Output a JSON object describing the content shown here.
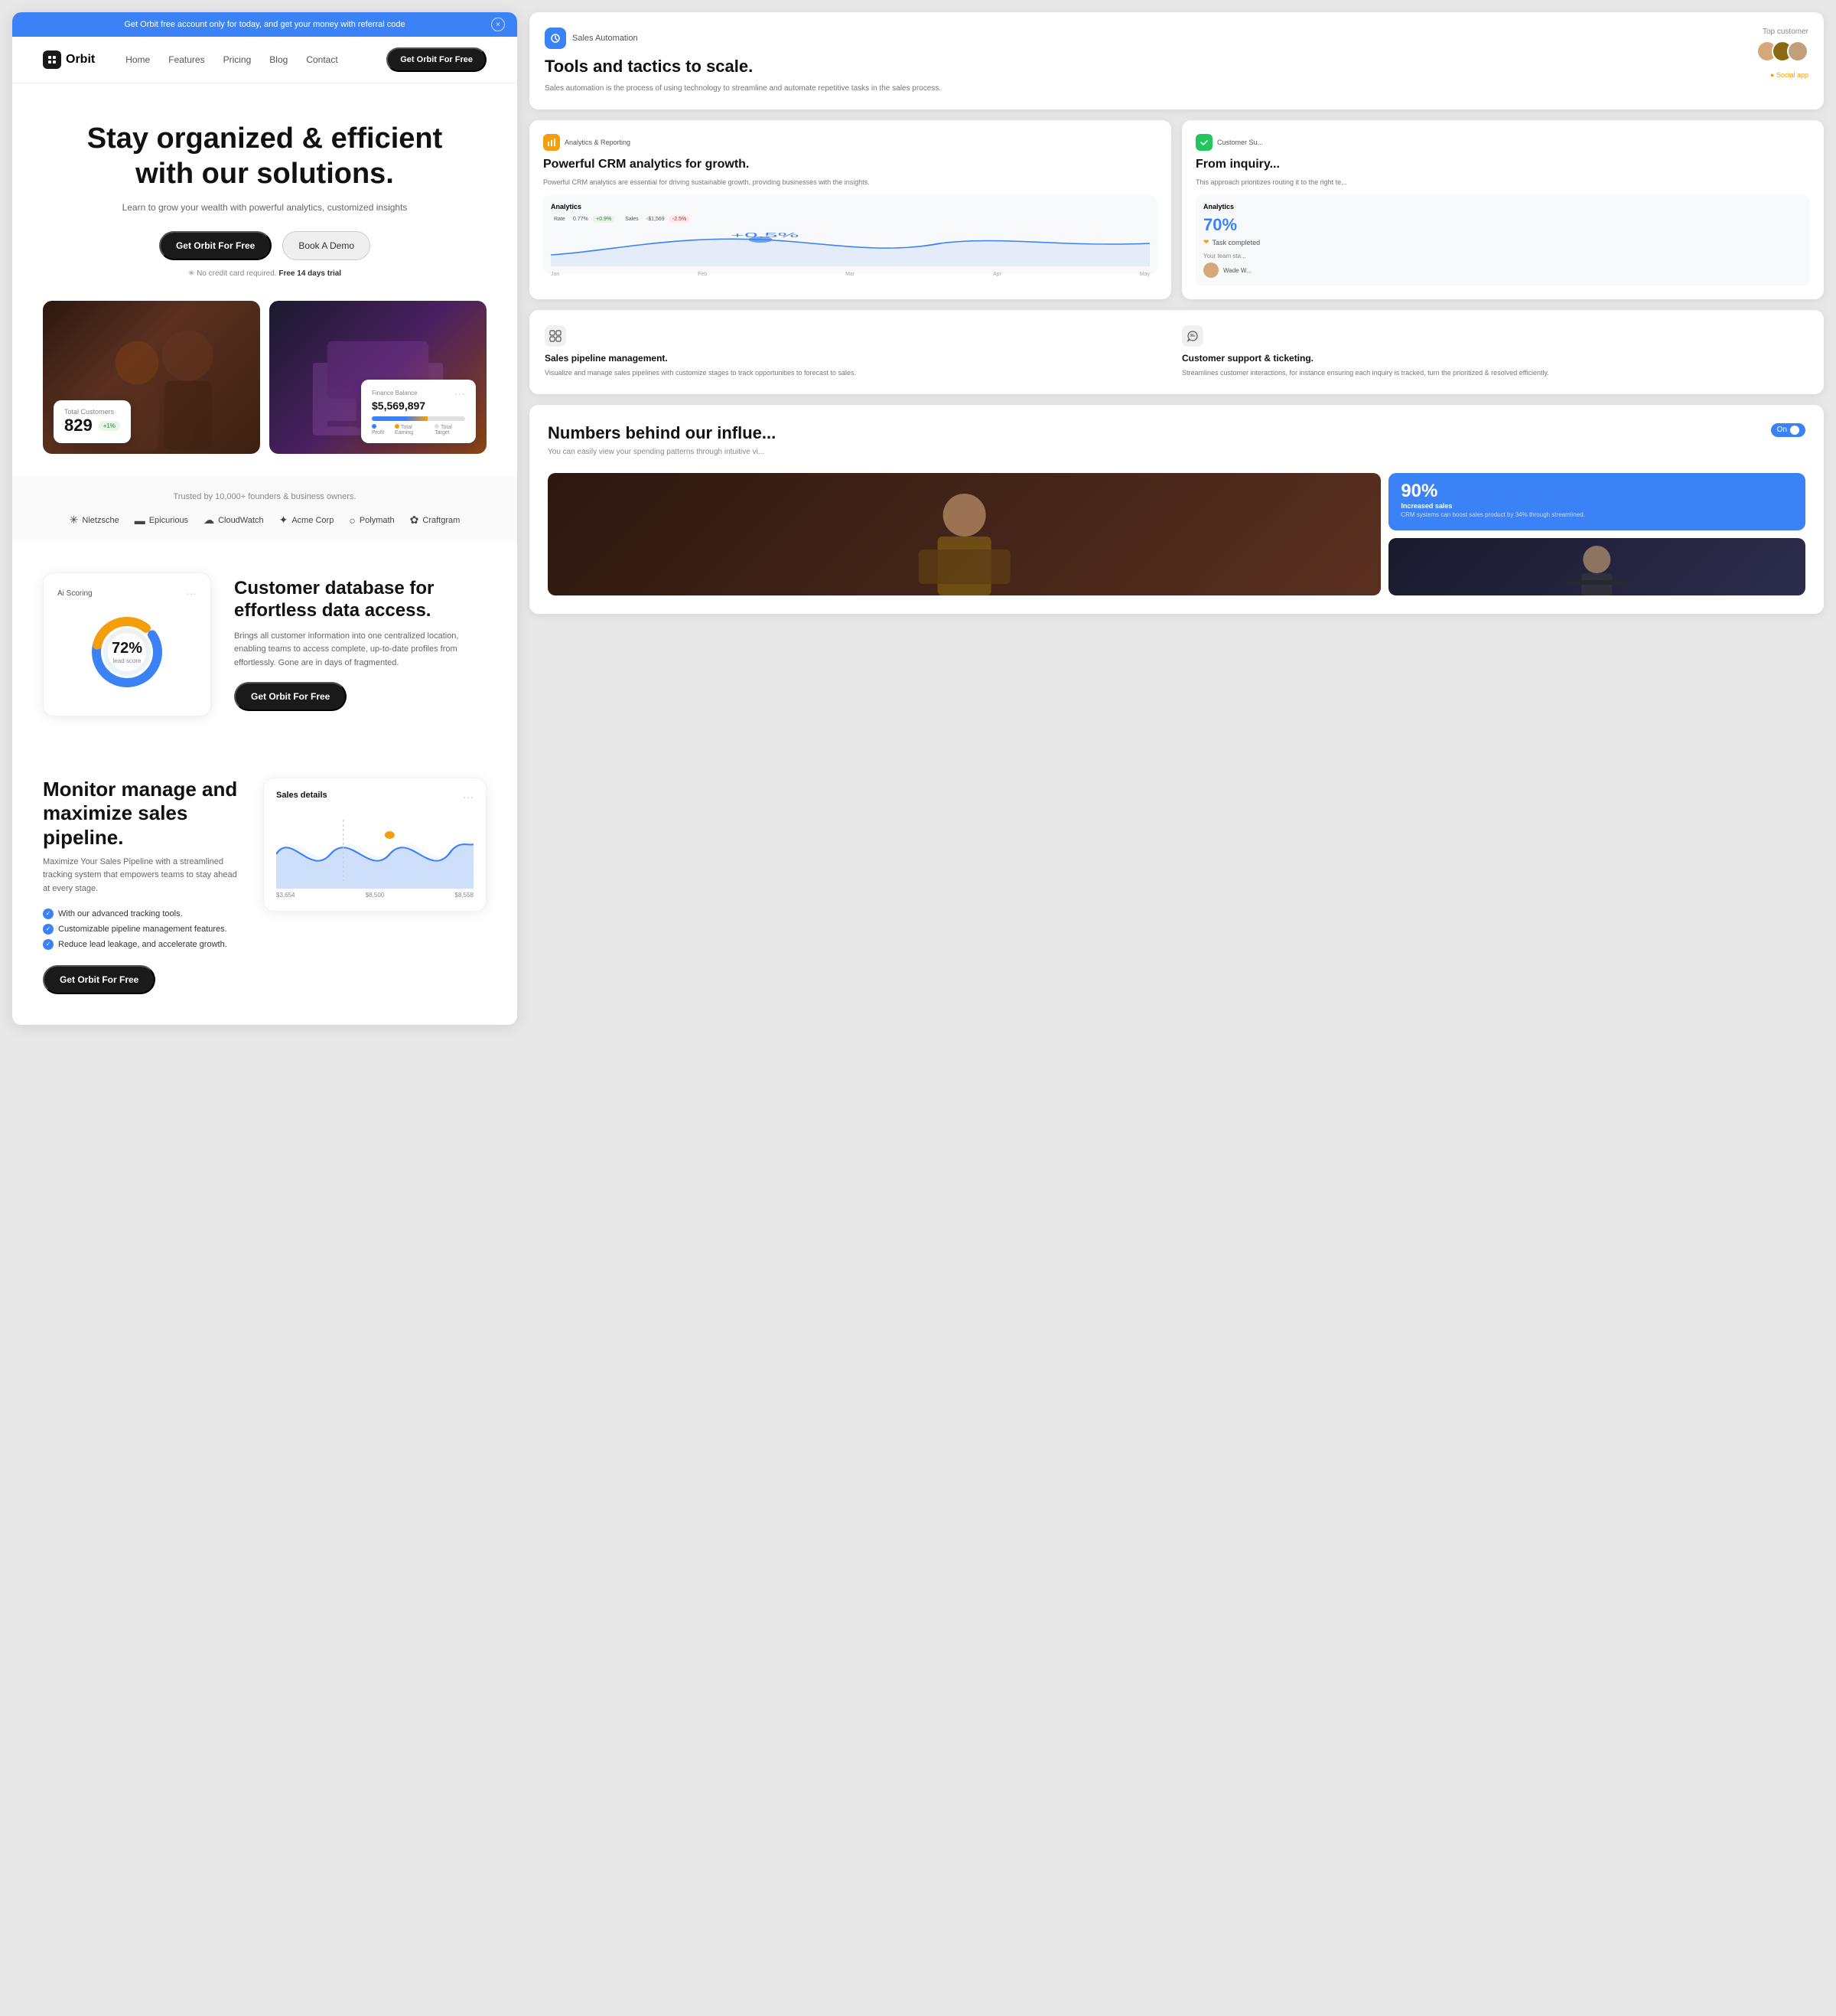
{
  "banner": {
    "text": "Get Orbit free account only for today, and get your money with referral code",
    "close_label": "×"
  },
  "nav": {
    "logo": "Orbit",
    "links": [
      "Home",
      "Features",
      "Pricing",
      "Blog",
      "Contact"
    ],
    "cta": "Get Orbit For Free"
  },
  "hero": {
    "heading_line1": "Stay organized & efficient",
    "heading_line2": "with our solutions.",
    "subtext": "Learn to grow your wealth with powerful analytics, customized insights",
    "cta_primary": "Get Orbit For Free",
    "cta_secondary": "Book A Demo",
    "note": "No credit card required.",
    "note_bold": "Free 14 days trial",
    "widget_customers_label": "Total Customers",
    "widget_customers_value": "829",
    "widget_customers_badge": "+1%",
    "finance_title": "Finance Balance",
    "finance_value": "$5,569,897",
    "finance_legend_1": "Profit",
    "finance_legend_2": "Total Earning",
    "finance_legend_3": "Total Target"
  },
  "trusted": {
    "label": "Trusted by 10,000+ founders & business owners.",
    "logos": [
      {
        "name": "Nietzsche",
        "icon": "✳"
      },
      {
        "name": "Epicurious",
        "icon": "▬"
      },
      {
        "name": "CloudWatch",
        "icon": "☁"
      },
      {
        "name": "Acme Corp",
        "icon": "✦"
      },
      {
        "name": "Polymath",
        "icon": "○"
      },
      {
        "name": "Craftgram",
        "icon": "✿"
      }
    ]
  },
  "ai_scoring": {
    "title": "Ai Scoring",
    "percentage": "72%",
    "sublabel": "lead score"
  },
  "customer_db": {
    "heading": "Customer database for effortless data access.",
    "body": "Brings all customer information into one centralized location, enabling teams to access complete, up-to-date profiles from effortlessly. Gone are in days of fragmented.",
    "cta": "Get Orbit For Free"
  },
  "sales_pipeline": {
    "heading_line1": "Monitor manage and",
    "heading_line2": "maximize sales pipeline.",
    "body": "Maximize Your Sales Pipeline with a streamlined tracking system that empowers teams to stay ahead at every stage.",
    "checklist": [
      "With our advanced tracking tools.",
      "Customizable pipeline management features.",
      "Reduce lead leakage, and accelerate growth."
    ],
    "cta": "Get Orbit For Free",
    "chart_title": "Sales details",
    "chart_labels": [
      "$3,654",
      "$8,500",
      "$8,558"
    ]
  },
  "right_panel": {
    "sales_automation": {
      "badge": "Sales Automation",
      "heading": "Tools and tactics to scale.",
      "body": "Sales automation is the process of using technology to streamline and automate repetitive tasks in the sales process.",
      "top_customer_label": "Top customer"
    },
    "analytics_card": {
      "badge": "Analytics & Reporting",
      "heading": "Powerful CRM analytics for growth.",
      "body": "Powerful CRM analytics are essential for driving sustainable growth, providing businesses with the insights.",
      "mini_title": "Analytics",
      "rate_label": "Rate",
      "rate_value": "0.77%",
      "rate_badge": "+0.9%",
      "sales_label": "Sales",
      "sales_value": "-$1,569",
      "sales_badge": "-2.5%",
      "chart_months": [
        "Jan",
        "Feb",
        "Mar",
        "Apr",
        "May"
      ],
      "chart_values": [
        0.4,
        0.5,
        0.8,
        0.6,
        0.7
      ]
    },
    "customer_success": {
      "badge": "Customer Su...",
      "heading": "From inquiry...",
      "body": "This approach prioritizes routing it to the right te...",
      "mini_title": "Analytics",
      "percentage": "70%",
      "label": "Task completed",
      "team_label": "Your team sta...",
      "user_name": "Wade W..."
    },
    "features": [
      {
        "icon": "⊞",
        "title": "Sales pipeline management.",
        "desc": "Visualize and manage sales pipelines with customize stages to track opportunities to forecast to sales."
      },
      {
        "icon": "↺",
        "title": "Customer support & ticketing.",
        "desc": "Streamlines customer interactions, for instance ensuring each inquiry is tracked, turn the prioritized & resolved efficiently."
      }
    ],
    "numbers": {
      "title": "Numbers behind our influe...",
      "subtitle": "You can easily view your spending patterns through intuitive vi...",
      "toggle_label": "On",
      "stat_pct": "90%",
      "stat_label": "Increased sales",
      "stat_desc": "CRM systems can boost sales product by 34% through streamlined."
    }
  }
}
